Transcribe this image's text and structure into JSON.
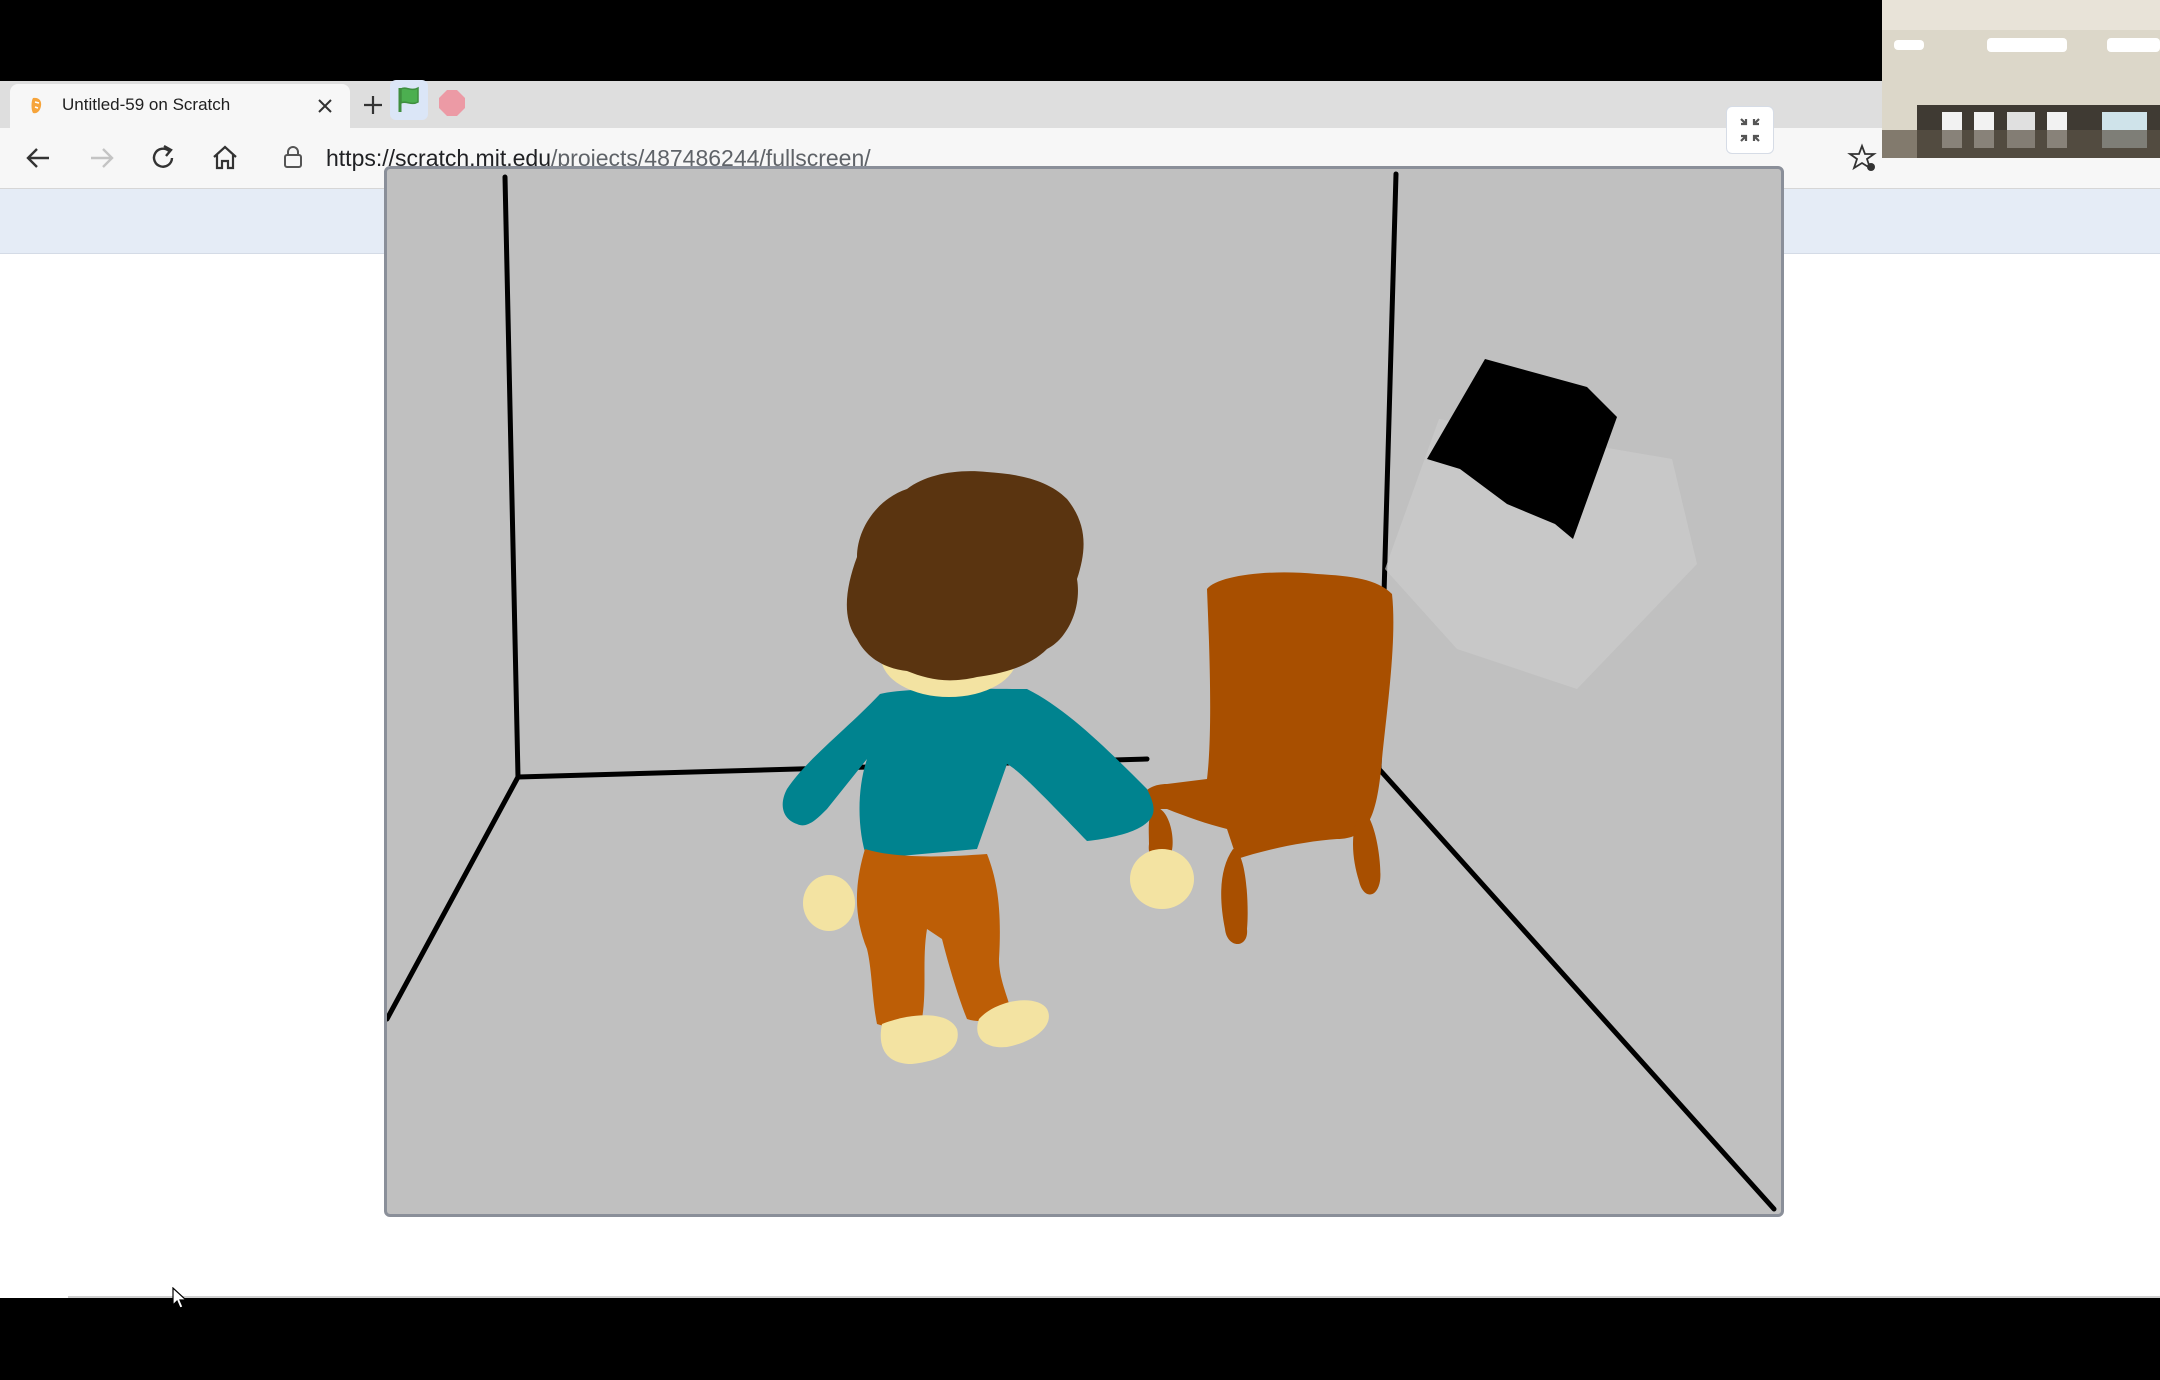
{
  "browser": {
    "tab": {
      "title": "Untitled-59 on Scratch",
      "favicon": "scratch-cat-icon"
    },
    "address": {
      "url_host": "https://scratch.mit.edu",
      "url_path": "/projects/487486244/fullscreen/"
    },
    "icons": [
      "back-arrow-icon",
      "forward-arrow-icon",
      "reload-icon",
      "home-icon",
      "lock-icon",
      "favorite-star-icon",
      "close-icon",
      "plus-icon"
    ]
  },
  "scratch": {
    "controls": [
      "green-flag-icon",
      "stop-icon",
      "exit-fullscreen-icon"
    ],
    "colors": {
      "flag": "#4caf50",
      "stop": "#ec9aa5",
      "stage_bg": "#c0c0c0"
    }
  },
  "stage_scene": {
    "objects": [
      "room-corner-lines",
      "window",
      "chair",
      "character"
    ],
    "colors": {
      "hair": "#5a3410",
      "shirt": "#00838f",
      "pants": "#bd5e06",
      "skin": "#f3e3a2",
      "chair": "#a84f00",
      "window": "#000000",
      "lines": "#000000"
    }
  }
}
